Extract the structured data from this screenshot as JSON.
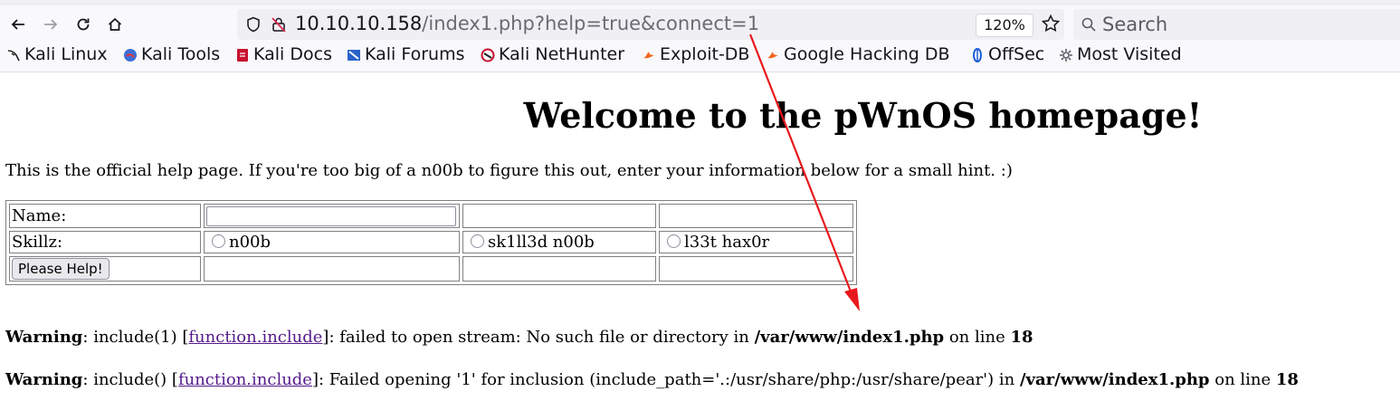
{
  "browser": {
    "url_host": "10.10.10.158",
    "url_path": "/index1.php?help=true&connect=1",
    "zoom": "120%",
    "search_placeholder": "Search",
    "bookmarks": [
      "Kali Linux",
      "Kali Tools",
      "Kali Docs",
      "Kali Forums",
      "Kali NetHunter",
      "Exploit-DB",
      "Google Hacking DB",
      "OffSec",
      "Most Visited"
    ]
  },
  "page": {
    "title": "Welcome to the pWnOS homepage!",
    "intro": "This is the official help page. If you're too big of a n00b to figure this out, enter your information below for a small hint. :)",
    "form": {
      "name_label": "Name:",
      "skill_label": "Skillz:",
      "skill_options": [
        "n00b",
        "sk1ll3d n00b",
        "l33t hax0r"
      ],
      "submit_label": "Please Help!"
    },
    "warnings": [
      {
        "label": "Warning",
        "before": ": include(1) [",
        "link": "function.include",
        "after": "]: failed to open stream: No such file or directory in ",
        "file": "/var/www/index1.php",
        "line_word": " on line ",
        "line": "18"
      },
      {
        "label": "Warning",
        "before": ": include() [",
        "link": "function.include",
        "after": "]: Failed opening '1' for inclusion (include_path='.:/usr/share/php:/usr/share/pear') in ",
        "file": "/var/www/index1.php",
        "line_word": " on line ",
        "line": "18"
      }
    ]
  },
  "colors": {
    "annotation_arrow": "#e8191c",
    "visited_link": "#551a8b"
  }
}
